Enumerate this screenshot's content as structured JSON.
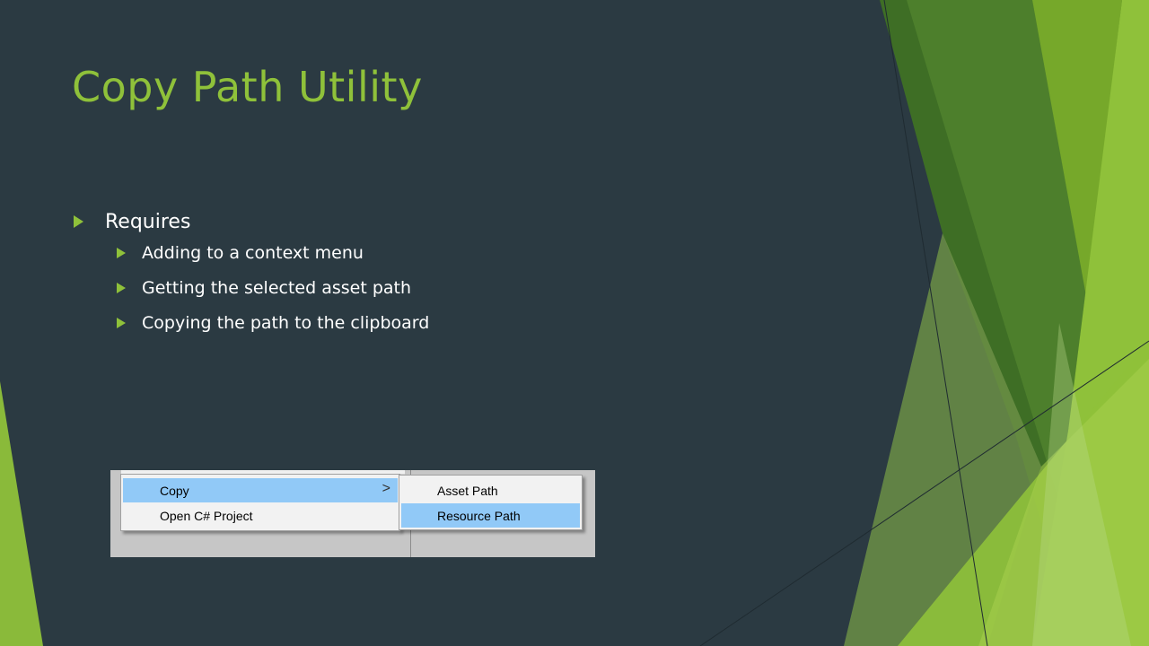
{
  "slide": {
    "title": "Copy Path Utility",
    "bullets": {
      "main": "Requires",
      "sub": [
        "Adding to a context menu",
        "Getting the selected asset path",
        "Copying the path to the clipboard"
      ]
    }
  },
  "context_menu": {
    "items": [
      {
        "label": "Copy",
        "highlighted": true,
        "has_submenu": true
      },
      {
        "label": "Open C# Project",
        "highlighted": false,
        "has_submenu": false
      }
    ],
    "submenu": {
      "items": [
        {
          "label": "Asset Path",
          "highlighted": false
        },
        {
          "label": "Resource Path",
          "highlighted": true
        }
      ]
    },
    "submenu_indicator": ">"
  },
  "colors": {
    "background": "#2b3a42",
    "accent": "#8fc13a",
    "text": "#ffffff",
    "menu_highlight": "#91c9f7"
  },
  "icons": [
    "triangle-bullet-icon",
    "chevron-right-icon"
  ]
}
